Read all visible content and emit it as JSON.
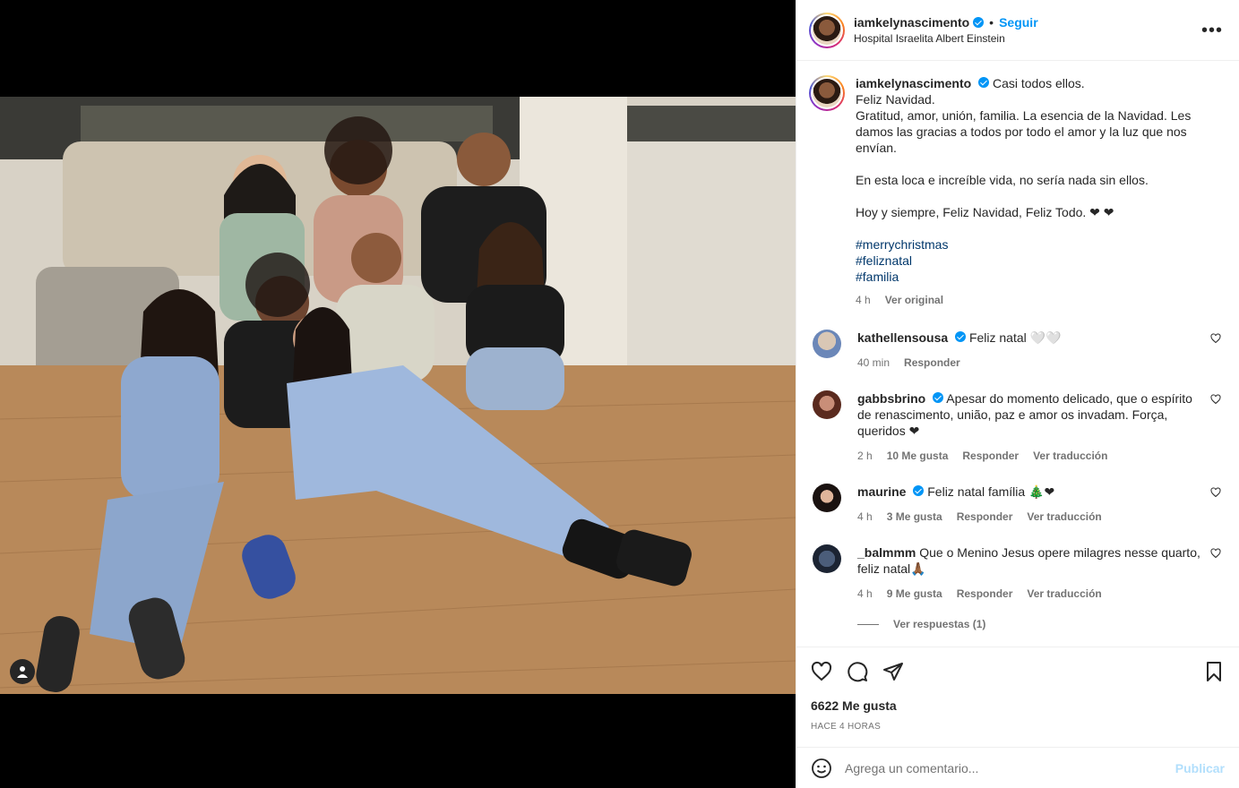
{
  "post": {
    "username": "iamkelynascimento",
    "follow_label": "Seguir",
    "location": "Hospital Israelita Albert Einstein",
    "more_label": "•••"
  },
  "caption": {
    "username": "iamkelynascimento",
    "line1": "Casi todos ellos.",
    "line2": "Feliz Navidad.",
    "line3": "Gratitud, amor, unión, familia. La esencia de la Navidad. Les damos las gracias a todos por todo el amor y la luz que nos envían.",
    "line4": "En esta loca e increíble vida, no sería nada sin ellos.",
    "line5": "Hoy y siempre, Feliz Navidad, Feliz Todo. ❤ ❤",
    "hashtags": [
      "#merrychristmas",
      "#feliznatal",
      "#familia"
    ],
    "time": "4 h",
    "see_original": "Ver original"
  },
  "comments": [
    {
      "username": "kathellensousa",
      "text": "Feliz natal 🤍🤍",
      "time": "40 min",
      "likes": "",
      "reply": "Responder",
      "translate": ""
    },
    {
      "username": "gabbsbrino",
      "text": "Apesar do momento delicado, que o espírito de renascimento, união, paz e amor os invadam. Força, queridos ❤",
      "time": "2 h",
      "likes": "10 Me gusta",
      "reply": "Responder",
      "translate": "Ver traducción"
    },
    {
      "username": "maurine",
      "text": "Feliz natal família 🎄❤",
      "time": "4 h",
      "likes": "3 Me gusta",
      "reply": "Responder",
      "translate": "Ver traducción"
    },
    {
      "username": "_balmmm",
      "text": "Que o Menino Jesus opere milagres nesse quarto, feliz natal🙏🏾",
      "time": "4 h",
      "likes": "9 Me gusta",
      "reply": "Responder",
      "translate": "Ver traducción"
    }
  ],
  "view_replies": "Ver respuestas (1)",
  "footer": {
    "likes": "6622 Me gusta",
    "ago": "HACE 4 HORAS",
    "comment_placeholder": "Agrega un comentario...",
    "publish": "Publicar"
  },
  "colors": {
    "accent": "#0095f6",
    "link": "#00376b",
    "muted": "#737373"
  },
  "icons": [
    "user-tag-icon",
    "heart-icon",
    "comment-icon",
    "share-icon",
    "bookmark-icon",
    "emoji-icon",
    "verified-icon",
    "more-icon"
  ]
}
